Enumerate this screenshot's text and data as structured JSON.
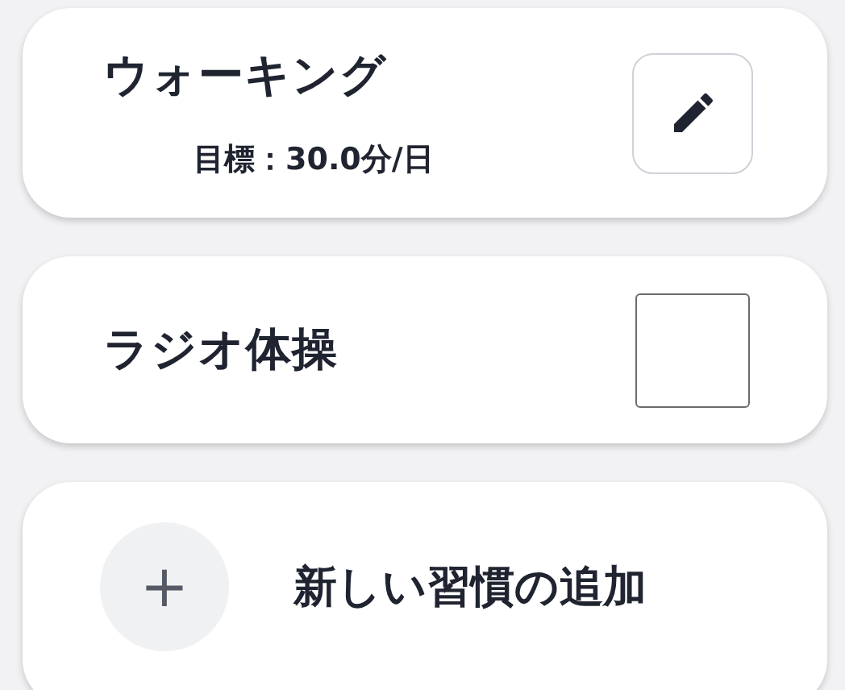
{
  "habits": [
    {
      "kind": "goal",
      "name": "ウォーキング",
      "goal": "目標：30.0分/日"
    },
    {
      "kind": "check",
      "name": "ラジオ体操",
      "checked": false
    }
  ],
  "add_habit": {
    "icon": "+",
    "label": "新しい習慣の追加"
  }
}
